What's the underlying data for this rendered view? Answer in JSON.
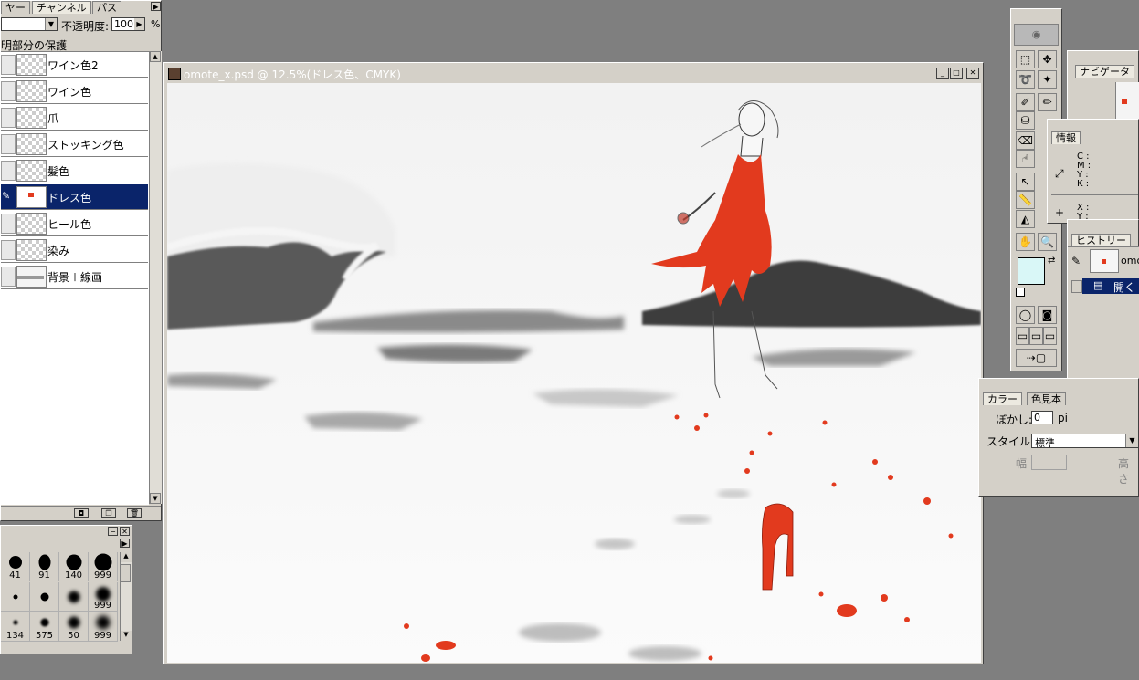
{
  "layers_panel": {
    "tabs": [
      "ヤー",
      "チャンネル",
      "パス"
    ],
    "opacity_label": "不透明度:",
    "opacity_value": "100",
    "opacity_unit": "%",
    "lock_label": "明部分の保護",
    "layers": [
      {
        "name": "ワイン色2",
        "selected": false
      },
      {
        "name": "ワイン色",
        "selected": false
      },
      {
        "name": "爪",
        "selected": false
      },
      {
        "name": "ストッキング色",
        "selected": false
      },
      {
        "name": "髪色",
        "selected": false
      },
      {
        "name": "ドレス色",
        "selected": true
      },
      {
        "name": "ヒール色",
        "selected": false
      },
      {
        "name": "染み",
        "selected": false
      },
      {
        "name": "背景＋線画",
        "selected": false
      }
    ]
  },
  "brushes_panel": {
    "brushes": [
      "41",
      "91",
      "140",
      "999",
      "",
      "",
      "",
      "999",
      "134",
      "575",
      "50",
      "999"
    ]
  },
  "document_window": {
    "title": "omote_x.psd @ 12.5%(ドレス色、CMYK)"
  },
  "navigator_panel": {
    "tab": "ナビゲータ"
  },
  "info_panel": {
    "tab": "情報",
    "cmyk_labels": [
      "C :",
      "M :",
      "Y :",
      "K :"
    ],
    "xy_labels": [
      "X :",
      "Y :"
    ]
  },
  "history_panel": {
    "tab": "ヒストリー",
    "snapshot_label": "omo",
    "step_label": "開く"
  },
  "options_panel": {
    "tabs": [
      "カラー",
      "色見本"
    ],
    "feather_label": "ぼかし:",
    "feather_value": "0",
    "feather_unit": "pi",
    "style_label": "スタイル:",
    "style_value": "標準",
    "width_label": "幅",
    "height_label": "高さ"
  },
  "colors": {
    "workspace": "#7f7f7f",
    "panel": "#d4d0c8",
    "selection": "#0a246a",
    "dress_red": "#e23a1e",
    "foreground_swatch": "#d9f7f7",
    "background_swatch": "#000000"
  }
}
